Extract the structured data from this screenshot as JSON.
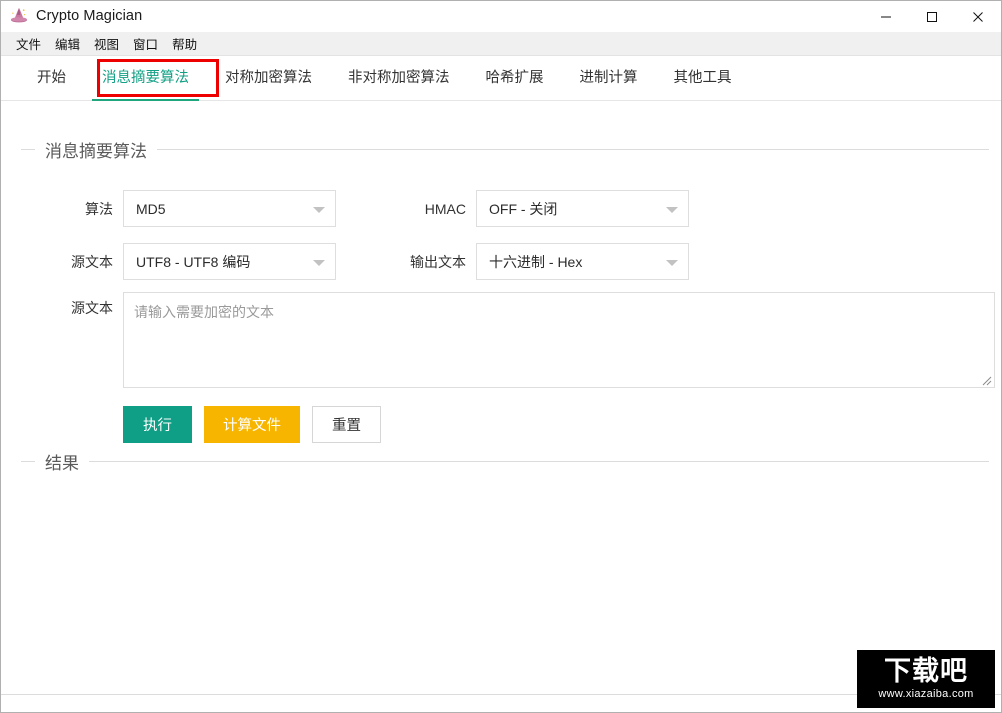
{
  "window": {
    "title": "Crypto Magician",
    "icon": "wizard-hat-icon",
    "controls": {
      "minimize": "—",
      "maximize": "□",
      "close": "✕"
    }
  },
  "menubar": {
    "items": [
      {
        "label": "文件"
      },
      {
        "label": "编辑"
      },
      {
        "label": "视图"
      },
      {
        "label": "窗口"
      },
      {
        "label": "帮助"
      }
    ]
  },
  "tabs": {
    "active_index": 1,
    "items": [
      {
        "label": "开始"
      },
      {
        "label": "消息摘要算法"
      },
      {
        "label": "对称加密算法"
      },
      {
        "label": "非对称加密算法"
      },
      {
        "label": "哈希扩展"
      },
      {
        "label": "进制计算"
      },
      {
        "label": "其他工具"
      }
    ],
    "highlight_color": "#ee0000",
    "active_color": "#14a085"
  },
  "digest_panel": {
    "legend": "消息摘要算法",
    "algorithm": {
      "label": "算法",
      "value": "MD5"
    },
    "hmac": {
      "label": "HMAC",
      "value": "OFF - 关闭"
    },
    "source_encoding": {
      "label": "源文本",
      "value": "UTF8 - UTF8 编码"
    },
    "output_encoding": {
      "label": "输出文本",
      "value": "十六进制 - Hex"
    },
    "source_text": {
      "label": "源文本",
      "value": "",
      "placeholder": "请输入需要加密的文本"
    },
    "buttons": {
      "execute": {
        "label": "执行",
        "color": "#0f9e86"
      },
      "compute_file": {
        "label": "计算文件",
        "color": "#f7b500"
      },
      "reset": {
        "label": "重置",
        "color": "#ffffff"
      }
    }
  },
  "result_panel": {
    "legend": "结果",
    "value": ""
  },
  "watermark": {
    "main": "下载吧",
    "sub": "www.xiazaiba.com"
  }
}
